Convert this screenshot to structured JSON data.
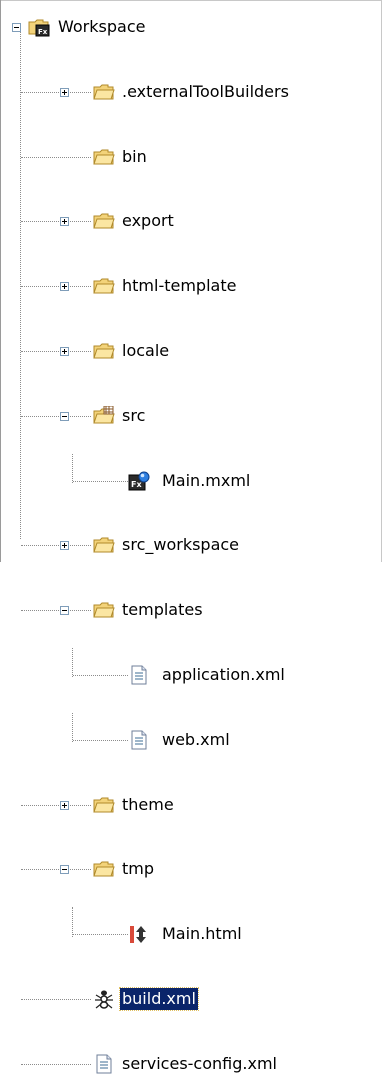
{
  "tree": {
    "root": {
      "label": "Workspace",
      "icon": "flex-project-icon",
      "expanded": true
    },
    "items": [
      {
        "label": ".externalToolBuilders",
        "icon": "folder-icon",
        "expandable": true,
        "expanded": false
      },
      {
        "label": "bin",
        "icon": "folder-icon",
        "expandable": false
      },
      {
        "label": "export",
        "icon": "folder-icon",
        "expandable": true,
        "expanded": false
      },
      {
        "label": "html-template",
        "icon": "folder-icon",
        "expandable": true,
        "expanded": false
      },
      {
        "label": "locale",
        "icon": "folder-icon",
        "expandable": true,
        "expanded": false
      },
      {
        "label": "src",
        "icon": "source-folder-icon",
        "expandable": true,
        "expanded": true,
        "children": [
          {
            "label": "Main.mxml",
            "icon": "mxml-file-icon"
          }
        ]
      },
      {
        "label": "src_workspace",
        "icon": "folder-icon",
        "expandable": true,
        "expanded": false
      },
      {
        "label": "templates",
        "icon": "folder-icon",
        "expandable": true,
        "expanded": true,
        "children": [
          {
            "label": "application.xml",
            "icon": "xml-file-icon"
          },
          {
            "label": "web.xml",
            "icon": "xml-file-icon"
          }
        ]
      },
      {
        "label": "theme",
        "icon": "folder-icon",
        "expandable": true,
        "expanded": false
      },
      {
        "label": "tmp",
        "icon": "folder-icon",
        "expandable": true,
        "expanded": true,
        "children": [
          {
            "label": "Main.html",
            "icon": "html-file-icon"
          }
        ]
      },
      {
        "label": "build.xml",
        "icon": "ant-build-file-icon",
        "expandable": false,
        "selected": true
      },
      {
        "label": "services-config.xml",
        "icon": "xml-file-icon",
        "expandable": false
      }
    ]
  },
  "colors": {
    "selection": "#0a246a",
    "selection_text": "#ffffff",
    "folder": "#f6d264",
    "connector": "#8c8c8c"
  }
}
